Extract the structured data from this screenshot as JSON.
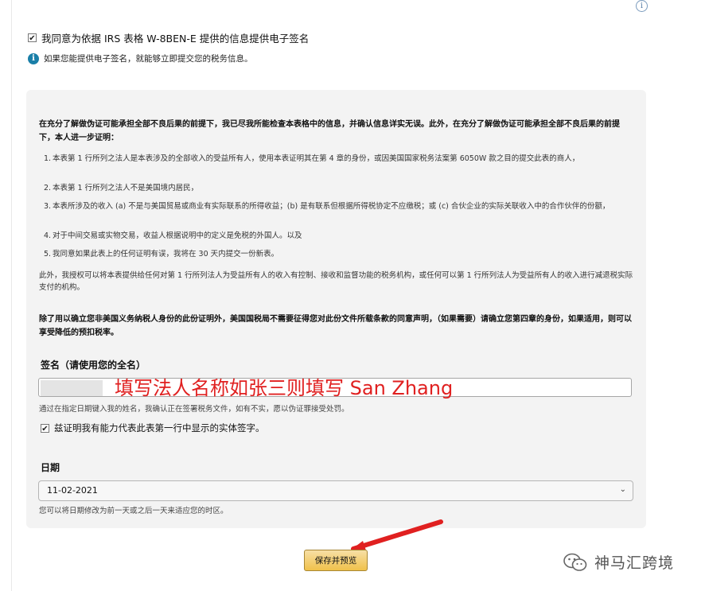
{
  "top_info_icon": "i",
  "agree": {
    "checked_mark": "✔",
    "label": "我同意为依据 IRS 表格 W-8BEN-E 提供的信息提供电子签名"
  },
  "hint": {
    "icon": "i",
    "text": "如果您能提供电子签名，就能够立即提交您的税务信息。"
  },
  "certification": {
    "intro": "在充分了解做伪证可能承担全部不良后果的前提下，我已尽我所能检查本表格中的信息，并确认信息详实无误。此外，在充分了解做伪证可能承担全部不良后果的前提下，本人进一步证明：",
    "clauses": [
      {
        "num": "1.",
        "text": "本表第 1 行所列之法人是本表涉及的全部收入的受益所有人，使用本表证明其在第 4 章的身份，或因美国国家税务法案第 6050W 款之目的提交此表的商人，"
      },
      {
        "num": "2.",
        "text": "本表第 1 行所列之法人不是美国境内居民，"
      },
      {
        "num": "3.",
        "text": "本表所涉及的收入 (a) 不是与美国贸易或商业有实际联系的所得收益；(b) 是有联系但根据所得税协定不应缴税；或 (c) 合伙企业的实际关联收入中的合作伙伴的份额，"
      },
      {
        "num": "4.",
        "text": "对于中间交易或实物交易，收益人根据说明中的定义是免税的外国人。以及"
      },
      {
        "num": "5.",
        "text": "我同意如果此表上的任何证明有误，我将在 30 天内提交一份新表。"
      }
    ],
    "authorization": "此外，我授权可以将本表提供给任何对第 1 行所列法人为受益所有人的收入有控制、接收和监督功能的税务机构，或任何可以第 1 行所列法人为受益所有人的收入进行减退税实际支付的机构。",
    "irs_note": "除了用以确立您非美国义务纳税人身份的此份证明外，美国国税局不需要征得您对此份文件所载条款的同意声明，（如果需要）请确立您第四章的身份，如果适用，则可以享受降低的预扣税率。"
  },
  "signature": {
    "label": "签名（请使用您的全名）",
    "annotation": "填写法人名称如张三则填写 San Zhang",
    "note": "通过在指定日期键入我的姓名，我确认正在签署税务文件，如有不实，愿以伪证罪接受处罚。",
    "confirm_mark": "✔",
    "confirm_label": "兹证明我有能力代表此表第一行中显示的实体签字。"
  },
  "date": {
    "label": "日期",
    "value": "11-02-2021",
    "chevron": "⌄",
    "note": "您可以将日期修改为前一天或之后一天来适应您的时区。"
  },
  "save_button": "保存并预览",
  "watermark": "神马汇跨境",
  "colors": {
    "annotation": "#e02020",
    "arrow": "#e02020",
    "button": "#f0c14b",
    "info": "#1a7fa8"
  }
}
